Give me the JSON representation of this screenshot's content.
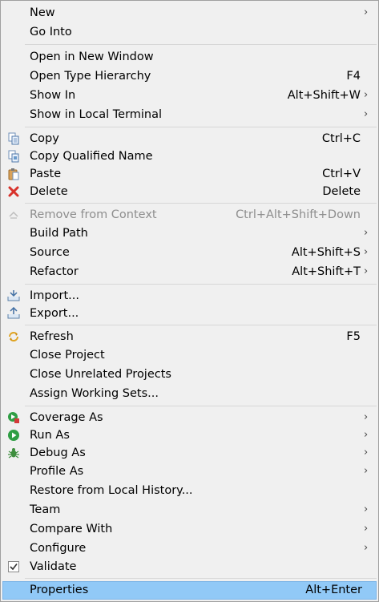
{
  "menu": {
    "new": {
      "label": "New"
    },
    "go_into": {
      "label": "Go Into"
    },
    "open_new_window": {
      "label": "Open in New Window"
    },
    "open_type_hierarchy": {
      "label": "Open Type Hierarchy",
      "shortcut": "F4"
    },
    "show_in": {
      "label": "Show In",
      "shortcut": "Alt+Shift+W"
    },
    "show_local_terminal": {
      "label": "Show in Local Terminal"
    },
    "copy": {
      "label": "Copy",
      "shortcut": "Ctrl+C",
      "icon": "copy-icon"
    },
    "copy_qualified_name": {
      "label": "Copy Qualified Name",
      "icon": "copy-qualified-name-icon"
    },
    "paste": {
      "label": "Paste",
      "shortcut": "Ctrl+V",
      "icon": "paste-icon"
    },
    "delete": {
      "label": "Delete",
      "shortcut": "Delete",
      "icon": "delete-icon"
    },
    "remove_from_context": {
      "label": "Remove from Context",
      "shortcut": "Ctrl+Alt+Shift+Down",
      "icon": "remove-context-icon",
      "disabled": true
    },
    "build_path": {
      "label": "Build Path"
    },
    "source": {
      "label": "Source",
      "shortcut": "Alt+Shift+S"
    },
    "refactor": {
      "label": "Refactor",
      "shortcut": "Alt+Shift+T"
    },
    "import": {
      "label": "Import...",
      "icon": "import-icon"
    },
    "export": {
      "label": "Export...",
      "icon": "export-icon"
    },
    "refresh": {
      "label": "Refresh",
      "shortcut": "F5",
      "icon": "refresh-icon"
    },
    "close_project": {
      "label": "Close Project"
    },
    "close_unrelated": {
      "label": "Close Unrelated Projects"
    },
    "assign_working_sets": {
      "label": "Assign Working Sets..."
    },
    "coverage_as": {
      "label": "Coverage As",
      "icon": "coverage-icon"
    },
    "run_as": {
      "label": "Run As",
      "icon": "run-icon"
    },
    "debug_as": {
      "label": "Debug As",
      "icon": "debug-icon"
    },
    "profile_as": {
      "label": "Profile As"
    },
    "restore_history": {
      "label": "Restore from Local History..."
    },
    "team": {
      "label": "Team"
    },
    "compare_with": {
      "label": "Compare With"
    },
    "configure": {
      "label": "Configure"
    },
    "validate": {
      "label": "Validate",
      "icon": "check-icon"
    },
    "properties": {
      "label": "Properties",
      "shortcut": "Alt+Enter",
      "highlighted": true
    }
  },
  "colors": {
    "background": "#f0f0f0",
    "highlight": "#91c9f7",
    "disabled_text": "#8e8e8e",
    "separator": "#d7d7d7"
  },
  "submenu_arrow": "›"
}
